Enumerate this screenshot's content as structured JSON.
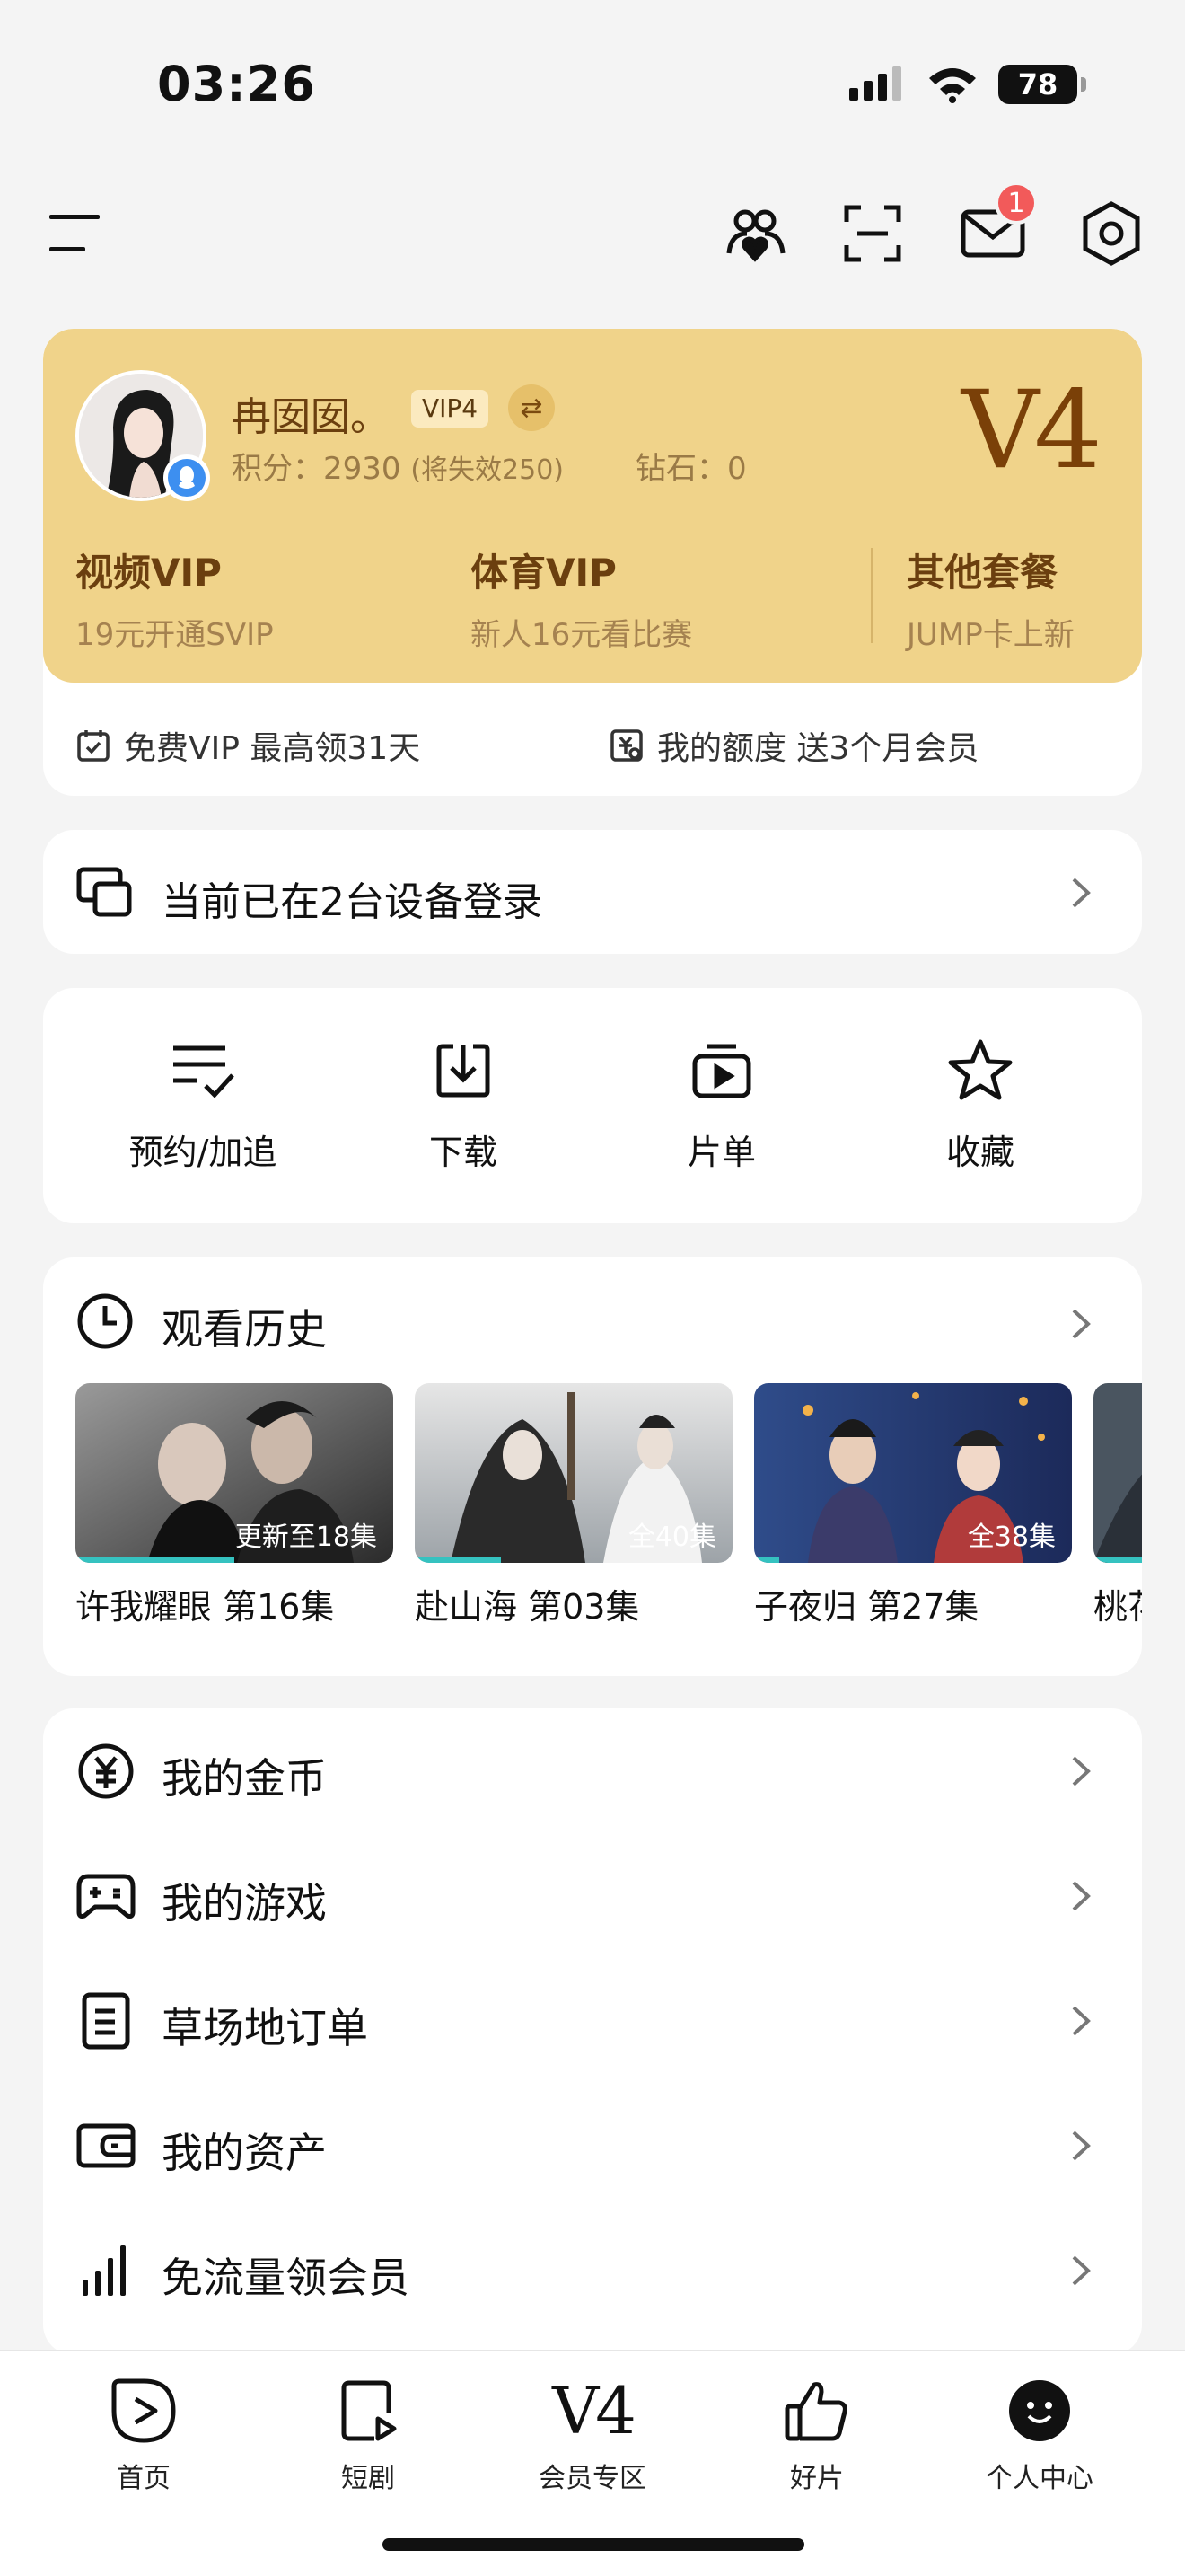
{
  "status_bar": {
    "time": "03:26",
    "battery": "78"
  },
  "toolbar": {
    "mail_badge": "1"
  },
  "profile": {
    "name": "冉囡囡。",
    "vip_chip": "VIP4",
    "points_label": "积分：2930",
    "points_note": "(将失效250)",
    "diamond": "钻石：0",
    "level": "V4"
  },
  "vip_options": [
    {
      "title": "视频VIP",
      "sub": "19元开通SVIP"
    },
    {
      "title": "体育VIP",
      "sub": "新人16元看比赛"
    },
    {
      "title": "其他套餐",
      "sub": "JUMP卡上新"
    }
  ],
  "vip_bottom": {
    "free_vip": "免费VIP 最高领31天",
    "quota": "我的额度 送3个月会员"
  },
  "device": {
    "label": "当前已在2台设备登录"
  },
  "quick_actions": [
    "预约/加追",
    "下载",
    "片单",
    "收藏"
  ],
  "history": {
    "title": "观看历史",
    "items": [
      {
        "name": "许我耀眼 第16集",
        "caption": "更新至18集",
        "progress": 0.5
      },
      {
        "name": "赴山海 第03集",
        "caption": "全40集",
        "progress": 0.27
      },
      {
        "name": "子夜归 第27集",
        "caption": "全38集",
        "progress": 0.08
      },
      {
        "name": "桃花",
        "caption": "",
        "progress": 0.9
      }
    ]
  },
  "menu": [
    "我的金币",
    "我的游戏",
    "草场地订单",
    "我的资产",
    "免流量领会员"
  ],
  "bottom_nav": {
    "home": "首页",
    "short": "短剧",
    "vip_mark": "V4",
    "vip": "会员专区",
    "good": "好片",
    "me": "个人中心"
  }
}
